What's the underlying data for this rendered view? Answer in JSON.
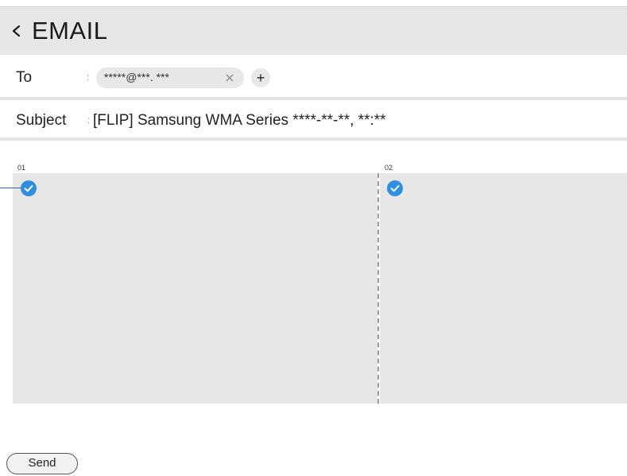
{
  "header": {
    "title": "EMAIL",
    "back_icon": "chevron-left-icon"
  },
  "to": {
    "label": "To",
    "separator": ":",
    "recipient": "*****@***. ***",
    "remove_icon": "close-icon",
    "add_label": "+"
  },
  "subject": {
    "label": "Subject",
    "separator": ":",
    "value": "[FLIP] Samsung WMA Series ****-**-**, **:**"
  },
  "pages": [
    {
      "number": "01",
      "selected": true,
      "icon": "check-circle-icon"
    },
    {
      "number": "02",
      "selected": true,
      "icon": "check-circle-icon"
    }
  ],
  "footer": {
    "send_label": "Send"
  },
  "colors": {
    "header_bg": "#e7e7e8",
    "panel_bg": "#e7e7e8",
    "accent": "#2f8fe0",
    "chip_bg": "#e8e8e8"
  }
}
